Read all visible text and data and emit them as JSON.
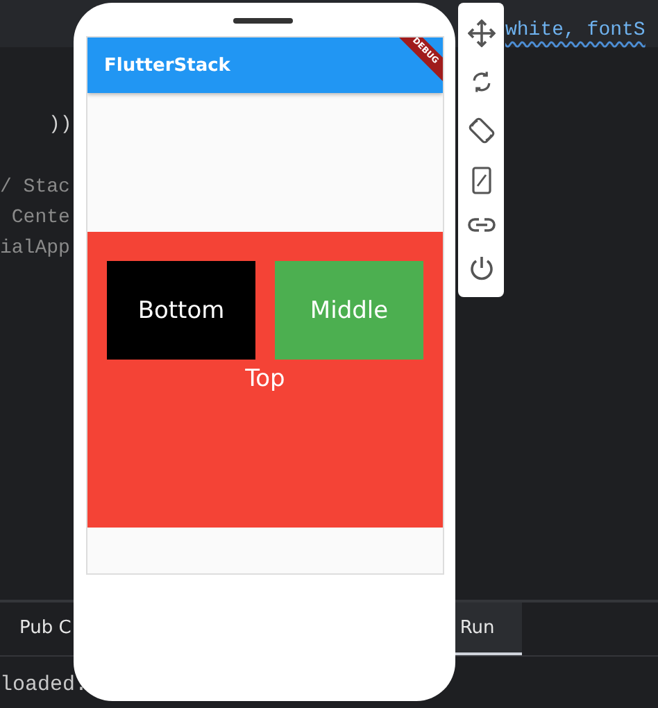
{
  "editor": {
    "code_lines": [
      {
        "text": "white, fontS",
        "kind": "warning"
      },
      {
        "text": "))",
        "kind": "normal"
      },
      {
        "text": "/ Stac",
        "kind": "dim"
      },
      {
        "text": " Cente",
        "kind": "dim"
      },
      {
        "text": "ialApp",
        "kind": "dim"
      }
    ]
  },
  "panel": {
    "tabs": [
      {
        "label": "Pub C",
        "selected": false
      },
      {
        "label": "Run",
        "selected": true
      }
    ],
    "output": "loaded."
  },
  "emulator": {
    "app_bar": {
      "title": "FlutterStack",
      "banner": "DEBUG"
    },
    "stack": [
      {
        "label": "Bottom",
        "color": "#000000"
      },
      {
        "label": "Middle",
        "color": "#4caf50"
      }
    ],
    "top_label": "Top"
  },
  "toolbar": [
    {
      "kind": "move"
    },
    {
      "kind": "rotate"
    },
    {
      "kind": "orientation"
    },
    {
      "kind": "resize"
    },
    {
      "kind": "link"
    },
    {
      "kind": "power"
    }
  ]
}
